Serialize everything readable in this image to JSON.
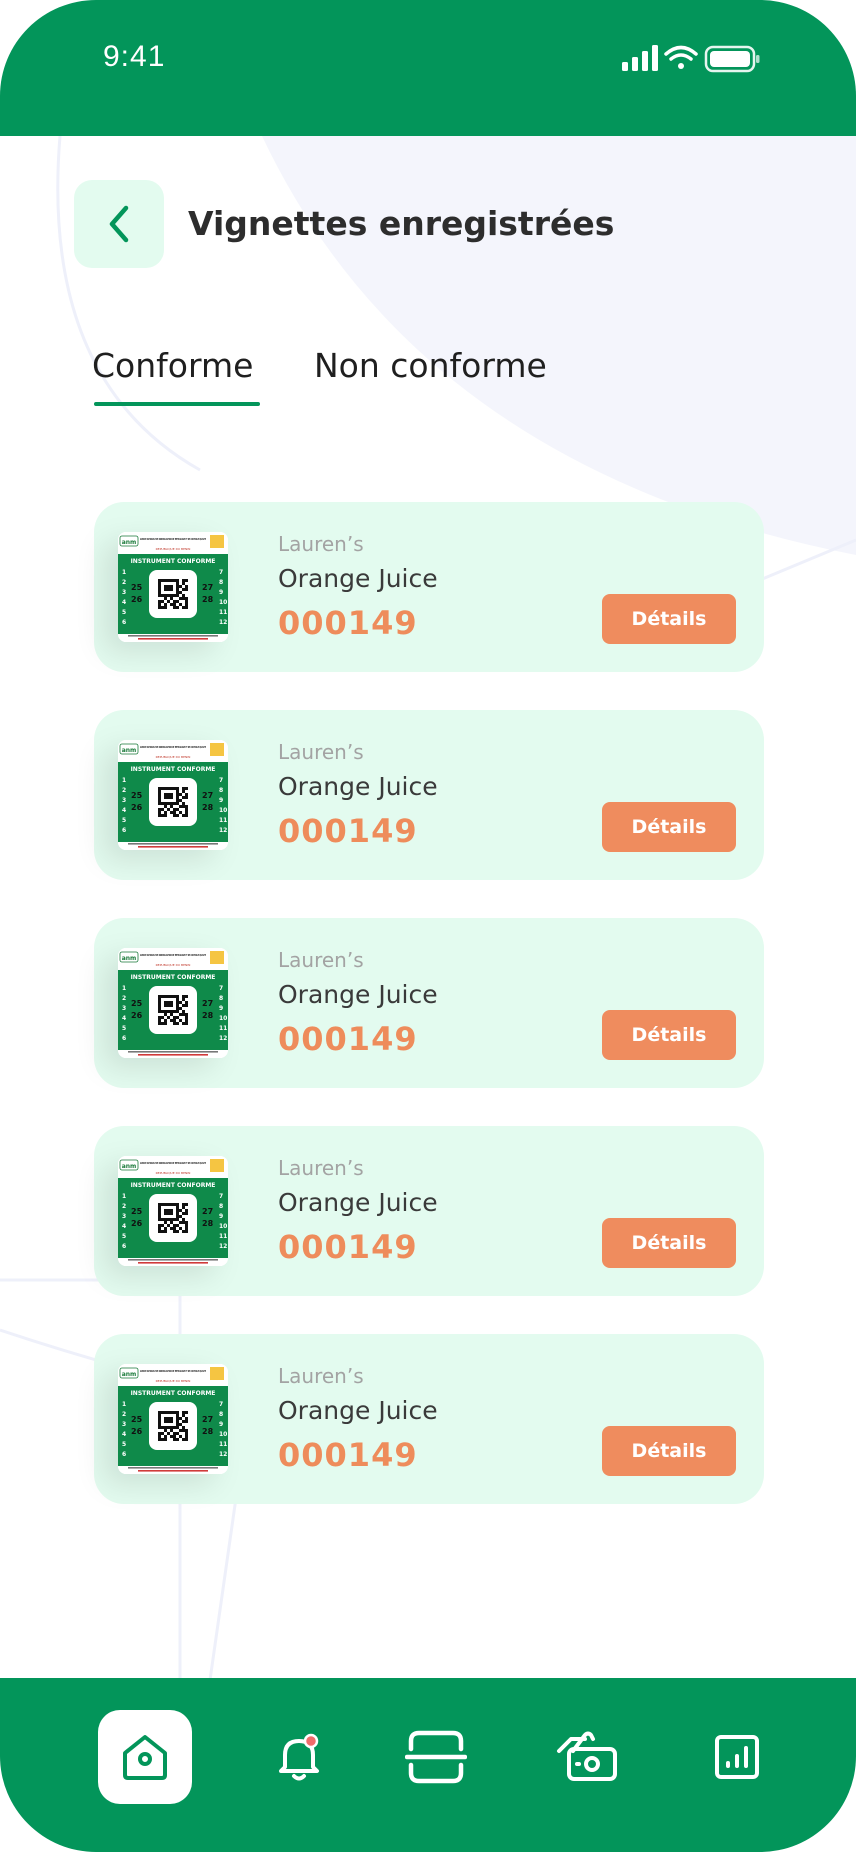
{
  "status_bar": {
    "time": "9:41"
  },
  "header": {
    "title": "Vignettes enregistrées"
  },
  "tabs": [
    {
      "label": "Conforme",
      "active": true
    },
    {
      "label": "Non conforme",
      "active": false
    }
  ],
  "items": [
    {
      "brand": "Lauren’s",
      "product": "Orange Juice",
      "code": "000149",
      "button": "Détails"
    },
    {
      "brand": "Lauren’s",
      "product": "Orange Juice",
      "code": "000149",
      "button": "Détails"
    },
    {
      "brand": "Lauren’s",
      "product": "Orange Juice",
      "code": "000149",
      "button": "Détails"
    },
    {
      "brand": "Lauren’s",
      "product": "Orange Juice",
      "code": "000149",
      "button": "Détails"
    },
    {
      "brand": "Lauren’s",
      "product": "Orange Juice",
      "code": "000149",
      "button": "Détails"
    }
  ],
  "vignette": {
    "logo": "anm",
    "header_text": "AGENCE NATIONALE DE NORMALISATION DE METROLOGIE ET DE CONTROLE QUALITE",
    "subheader": "REPUBLIQUE DU BENIN",
    "banner": "INSTRUMENT CONFORME",
    "left_numbers": [
      "1",
      "2",
      "3",
      "4",
      "5",
      "6"
    ],
    "right_numbers": [
      "7",
      "8",
      "9",
      "10",
      "11",
      "12"
    ],
    "years_left": [
      "25",
      "26"
    ],
    "years_right": [
      "27",
      "28"
    ]
  },
  "bottom_nav": [
    {
      "icon": "home-icon",
      "active": true
    },
    {
      "icon": "bell-icon",
      "active": false,
      "badge": true
    },
    {
      "icon": "scan-icon",
      "active": false
    },
    {
      "icon": "payment-icon",
      "active": false
    },
    {
      "icon": "chart-icon",
      "active": false
    }
  ],
  "colors": {
    "primary": "#03955a",
    "card_bg": "#e3fbef",
    "accent": "#ef8c5e",
    "badge": "#f06b6b"
  }
}
